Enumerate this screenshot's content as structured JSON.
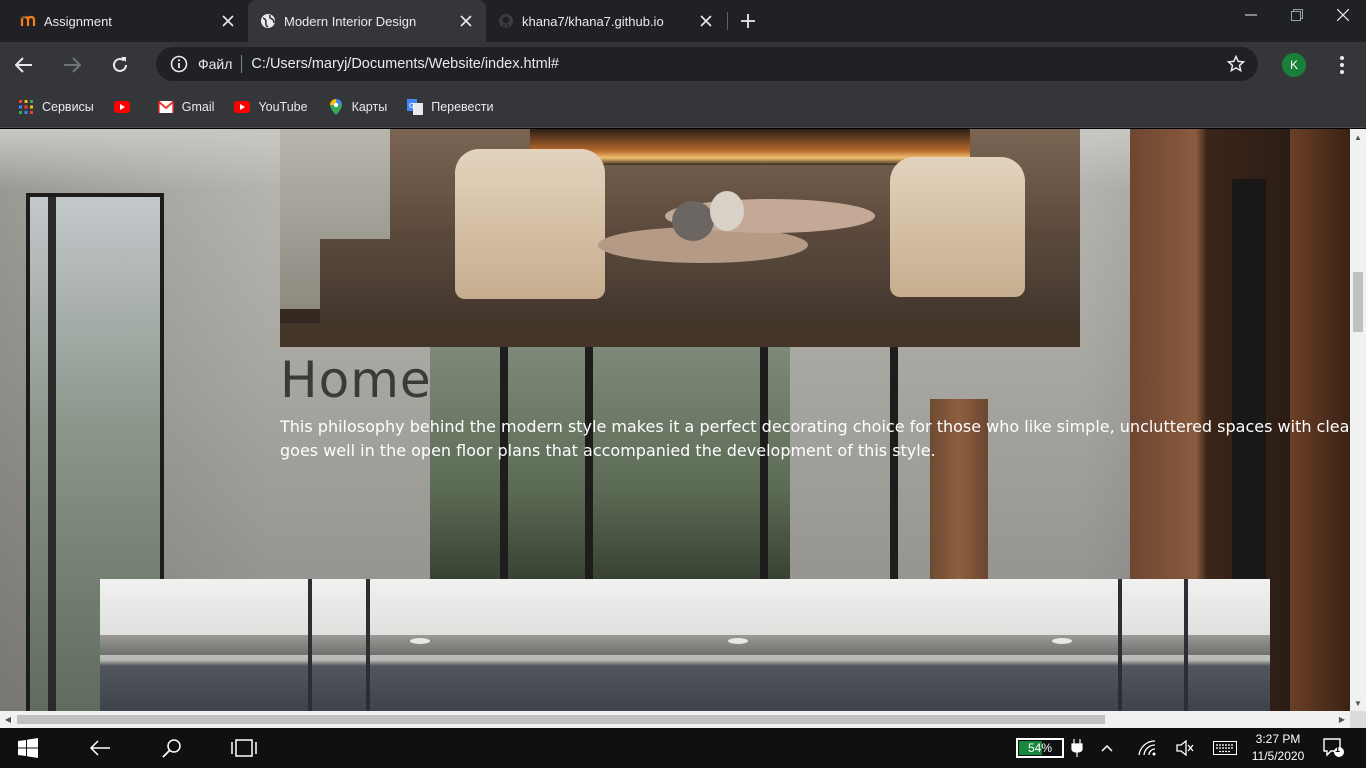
{
  "browser": {
    "tabs": [
      {
        "title": "Assignment",
        "active": false
      },
      {
        "title": "Modern Interior Design",
        "active": true
      },
      {
        "title": "khana7/khana7.github.io",
        "active": false
      }
    ],
    "address": {
      "scheme_label": "Файл",
      "url": "C:/Users/maryj/Documents/Website/index.html#"
    },
    "profile_initial": "K",
    "bookmarks": [
      {
        "label": "Сервисы",
        "icon": "apps-grid-icon"
      },
      {
        "label": "",
        "icon": "youtube-icon"
      },
      {
        "label": "Gmail",
        "icon": "gmail-icon"
      },
      {
        "label": "YouTube",
        "icon": "youtube-icon"
      },
      {
        "label": "Карты",
        "icon": "maps-icon"
      },
      {
        "label": "Перевести",
        "icon": "translate-icon"
      }
    ]
  },
  "page": {
    "heading": "Home",
    "paragraph_line1": "This philosophy behind the modern style makes it a perfect decorating choice for those who like simple, uncluttered spaces with clean lines. It",
    "paragraph_line2": "goes well in the open floor plans that accompanied the development of this style."
  },
  "scroll": {
    "vertical_fraction": 0.26,
    "horizontal_fraction": 0.0
  },
  "taskbar": {
    "battery_percent": "54%",
    "battery_level": 0.54,
    "time": "3:27 PM",
    "date": "11/5/2020",
    "notification_count": "1"
  },
  "colors": {
    "chrome_dark": "#202124",
    "chrome_toolbar": "#35363a",
    "profile_green": "#188038",
    "battery_green": "#17873b"
  }
}
